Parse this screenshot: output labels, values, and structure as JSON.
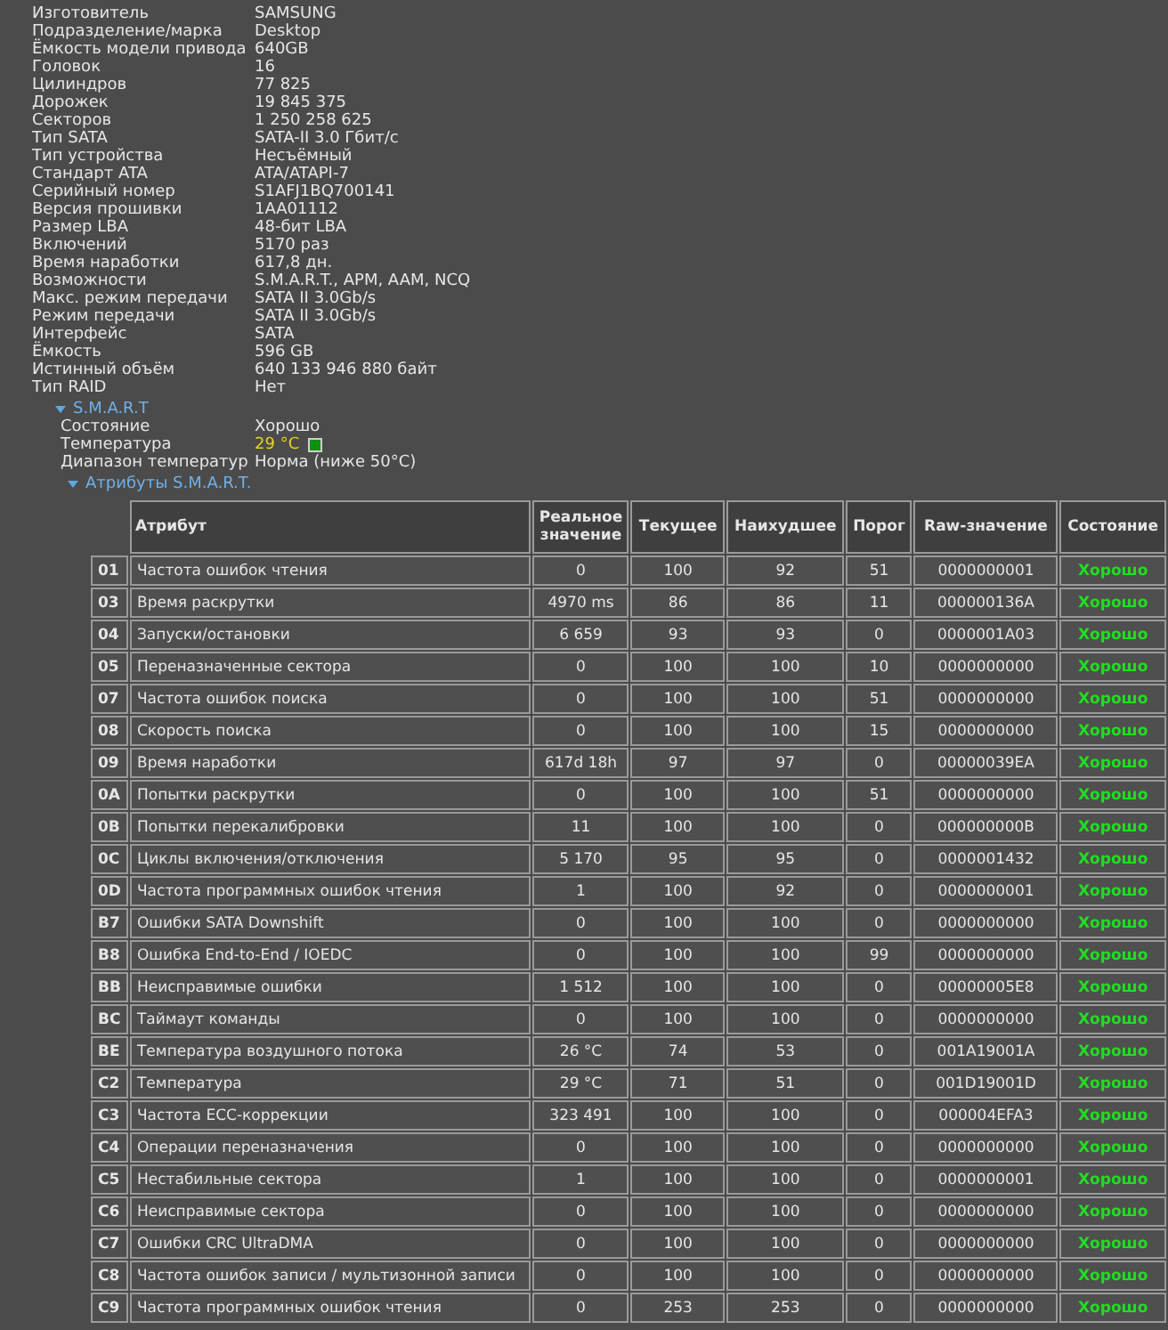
{
  "properties": [
    {
      "label": "Изготовитель",
      "value": "SAMSUNG"
    },
    {
      "label": "Подразделение/марка",
      "value": "Desktop"
    },
    {
      "label": "Ёмкость модели привода",
      "value": "640GB"
    },
    {
      "label": "Головок",
      "value": "16"
    },
    {
      "label": "Цилиндров",
      "value": "77 825"
    },
    {
      "label": "Дорожек",
      "value": "19 845 375"
    },
    {
      "label": "Секторов",
      "value": "1 250 258 625"
    },
    {
      "label": "Тип SATA",
      "value": "SATA-II 3.0 Гбит/с"
    },
    {
      "label": "Тип устройства",
      "value": "Несъёмный"
    },
    {
      "label": "Стандарт ATA",
      "value": "ATA/ATAPI-7"
    },
    {
      "label": "Серийный номер",
      "value": "S1AFJ1BQ700141"
    },
    {
      "label": "Версия прошивки",
      "value": "1AA01112"
    },
    {
      "label": "Размер LBA",
      "value": "48-бит LBA"
    },
    {
      "label": "Включений",
      "value": "5170 раз"
    },
    {
      "label": "Время наработки",
      "value": "617,8 дн."
    },
    {
      "label": "Возможности",
      "value": "S.M.A.R.T., APM, AAM, NCQ"
    },
    {
      "label": "Макс. режим передачи",
      "value": "SATA II 3.0Gb/s"
    },
    {
      "label": "Режим передачи",
      "value": "SATA II 3.0Gb/s"
    },
    {
      "label": "Интерфейс",
      "value": "SATA"
    },
    {
      "label": "Ёмкость",
      "value": "596 GB"
    },
    {
      "label": "Истинный объём",
      "value": "640 133 946 880 байт"
    },
    {
      "label": "Тип RAID",
      "value": "Нет"
    }
  ],
  "smart": {
    "title": "S.M.A.R.T",
    "expanded": true,
    "items": [
      {
        "label": "Состояние",
        "value": "Хорошо",
        "kind": "plain"
      },
      {
        "label": "Температура",
        "value": "29 °C",
        "kind": "temperature"
      },
      {
        "label": "Диапазон температур",
        "value": "Норма (ниже 50°C)",
        "kind": "plain"
      }
    ],
    "attributes": {
      "title": "Атрибуты S.M.A.R.T.",
      "expanded": true,
      "columns": [
        "",
        "Атрибут",
        "Реальное значение",
        "Текущее",
        "Наихудшее",
        "Порог",
        "Raw-значение",
        "Состояние"
      ],
      "rows": [
        [
          "01",
          "Частота ошибок чтения",
          "0",
          "100",
          "92",
          "51",
          "0000000001",
          "Хорошо"
        ],
        [
          "03",
          "Время раскрутки",
          "4970 ms",
          "86",
          "86",
          "11",
          "000000136A",
          "Хорошо"
        ],
        [
          "04",
          "Запуски/остановки",
          "6 659",
          "93",
          "93",
          "0",
          "0000001A03",
          "Хорошо"
        ],
        [
          "05",
          "Переназначенные сектора",
          "0",
          "100",
          "100",
          "10",
          "0000000000",
          "Хорошо"
        ],
        [
          "07",
          "Частота ошибок поиска",
          "0",
          "100",
          "100",
          "51",
          "0000000000",
          "Хорошо"
        ],
        [
          "08",
          "Скорость поиска",
          "0",
          "100",
          "100",
          "15",
          "0000000000",
          "Хорошо"
        ],
        [
          "09",
          "Время наработки",
          "617d 18h",
          "97",
          "97",
          "0",
          "00000039EA",
          "Хорошо"
        ],
        [
          "0A",
          "Попытки раскрутки",
          "0",
          "100",
          "100",
          "51",
          "0000000000",
          "Хорошо"
        ],
        [
          "0B",
          "Попытки перекалибровки",
          "11",
          "100",
          "100",
          "0",
          "000000000B",
          "Хорошо"
        ],
        [
          "0C",
          "Циклы включения/отключения",
          "5 170",
          "95",
          "95",
          "0",
          "0000001432",
          "Хорошо"
        ],
        [
          "0D",
          "Частота программных ошибок чтения",
          "1",
          "100",
          "92",
          "0",
          "0000000001",
          "Хорошо"
        ],
        [
          "B7",
          "Ошибки SATA Downshift",
          "0",
          "100",
          "100",
          "0",
          "0000000000",
          "Хорошо"
        ],
        [
          "B8",
          "Ошибка End-to-End / IOEDC",
          "0",
          "100",
          "100",
          "99",
          "0000000000",
          "Хорошо"
        ],
        [
          "BB",
          "Неисправимые ошибки",
          "1 512",
          "100",
          "100",
          "0",
          "00000005E8",
          "Хорошо"
        ],
        [
          "BC",
          "Таймаут команды",
          "0",
          "100",
          "100",
          "0",
          "0000000000",
          "Хорошо"
        ],
        [
          "BE",
          "Температура воздушного потока",
          "26 °C",
          "74",
          "53",
          "0",
          "001A19001A",
          "Хорошо"
        ],
        [
          "C2",
          "Температура",
          "29 °C",
          "71",
          "51",
          "0",
          "001D19001D",
          "Хорошо"
        ],
        [
          "C3",
          "Частота ECC-коррекции",
          "323 491",
          "100",
          "100",
          "0",
          "000004EFA3",
          "Хорошо"
        ],
        [
          "C4",
          "Операции переназначения",
          "0",
          "100",
          "100",
          "0",
          "0000000000",
          "Хорошо"
        ],
        [
          "C5",
          "Нестабильные сектора",
          "1",
          "100",
          "100",
          "0",
          "0000000001",
          "Хорошо"
        ],
        [
          "C6",
          "Неисправимые сектора",
          "0",
          "100",
          "100",
          "0",
          "0000000000",
          "Хорошо"
        ],
        [
          "C7",
          "Ошибки CRC UltraDMA",
          "0",
          "100",
          "100",
          "0",
          "0000000000",
          "Хорошо"
        ],
        [
          "C8",
          "Частота ошибок записи / мультизонной записи",
          "0",
          "100",
          "100",
          "0",
          "0000000000",
          "Хорошо"
        ],
        [
          "C9",
          "Частота программных ошибок чтения",
          "0",
          "253",
          "253",
          "0",
          "0000000000",
          "Хорошо"
        ]
      ]
    }
  }
}
